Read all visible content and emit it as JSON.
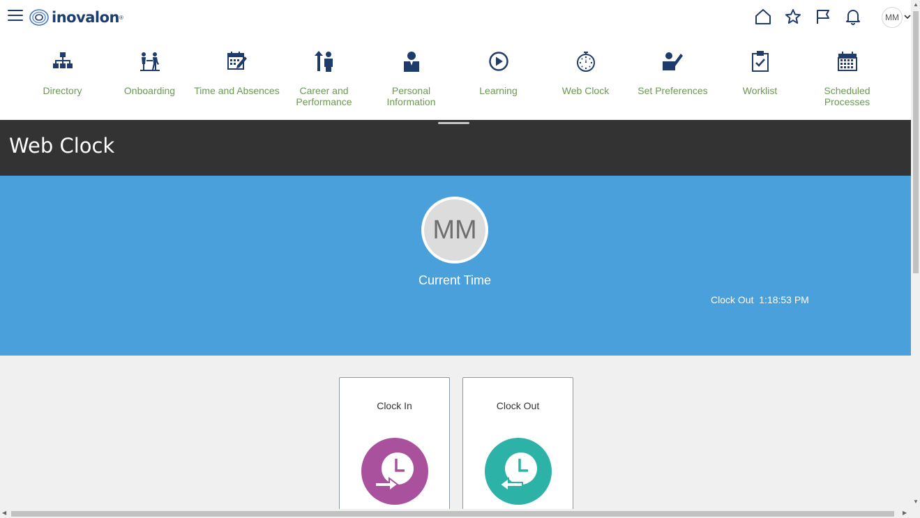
{
  "header": {
    "logo_text": "inovalon",
    "logo_mark": "®",
    "avatar_initials": "MM",
    "icons": [
      "home-icon",
      "star-icon",
      "flag-icon",
      "bell-icon"
    ]
  },
  "apps": [
    {
      "label": "Directory",
      "icon": "org-chart-icon"
    },
    {
      "label": "Onboarding",
      "icon": "onboarding-icon"
    },
    {
      "label": "Time and Absences",
      "icon": "calendar-edit-icon"
    },
    {
      "label": "Career and Performance",
      "icon": "career-icon"
    },
    {
      "label": "Personal Information",
      "icon": "person-icon"
    },
    {
      "label": "Learning",
      "icon": "play-icon"
    },
    {
      "label": "Web Clock",
      "icon": "stopwatch-icon"
    },
    {
      "label": "Set Preferences",
      "icon": "preferences-icon"
    },
    {
      "label": "Worklist",
      "icon": "clipboard-check-icon"
    },
    {
      "label": "Scheduled Processes",
      "icon": "calendar-grid-icon"
    }
  ],
  "page": {
    "title": "Web Clock"
  },
  "banner": {
    "avatar_initials": "MM",
    "current_time_label": "Current Time",
    "status_text": "Clock Out  1:18:53 PM"
  },
  "cards": {
    "clock_in": {
      "label": "Clock In",
      "color": "#a9519d"
    },
    "clock_out": {
      "label": "Clock Out",
      "color": "#2cb2a6"
    }
  },
  "colors": {
    "banner": "#4aa0db",
    "titlebar": "#333333",
    "nav_icon": "#1f3b6b",
    "app_label": "#6a9a52"
  }
}
